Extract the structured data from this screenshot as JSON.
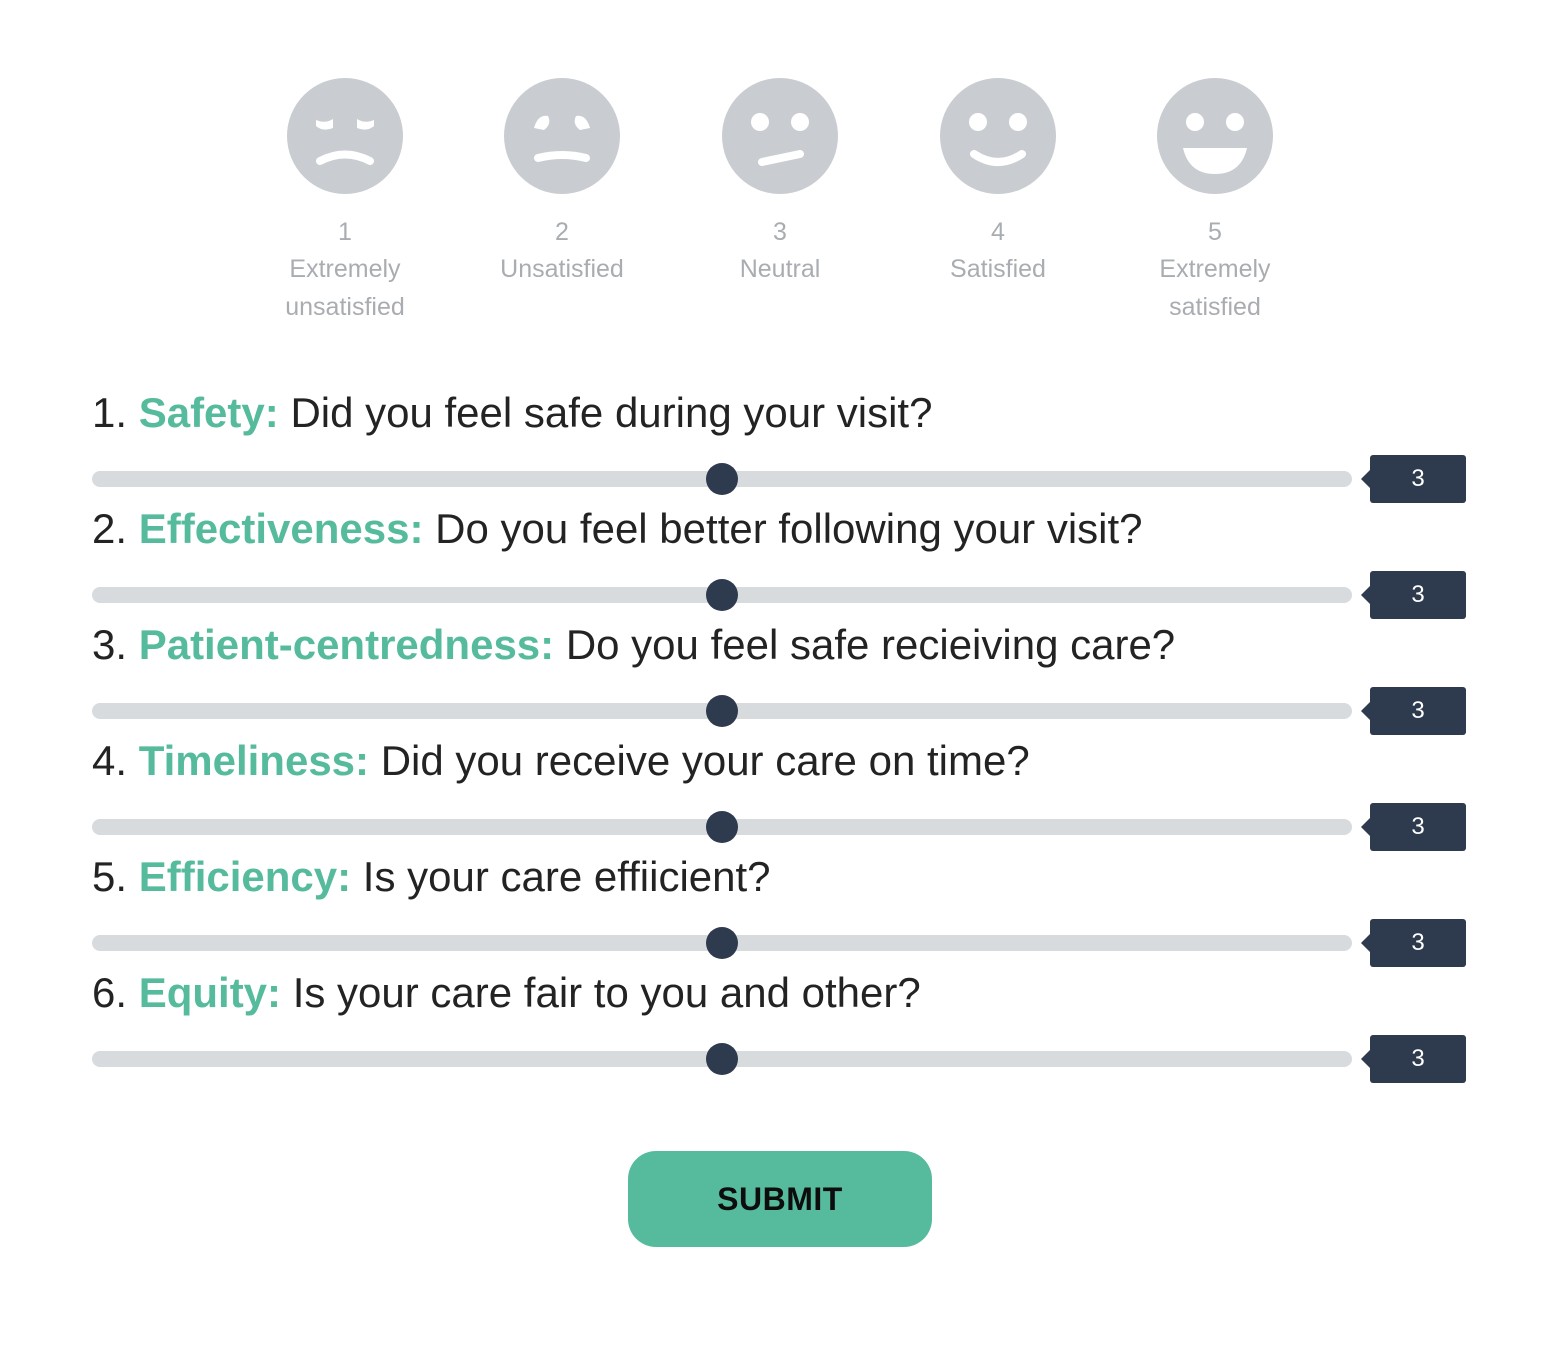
{
  "scale": [
    {
      "number": "1",
      "label_line1": "Extremely",
      "label_line2": "unsatisfied",
      "icon": "extremely-unsatisfied-face-icon"
    },
    {
      "number": "2",
      "label_line1": "Unsatisfied",
      "label_line2": "",
      "icon": "unsatisfied-face-icon"
    },
    {
      "number": "3",
      "label_line1": "Neutral",
      "label_line2": "",
      "icon": "neutral-face-icon"
    },
    {
      "number": "4",
      "label_line1": "Satisfied",
      "label_line2": "",
      "icon": "satisfied-face-icon"
    },
    {
      "number": "5",
      "label_line1": "Extremely",
      "label_line2": "satisfied",
      "icon": "extremely-satisfied-face-icon"
    }
  ],
  "slider_range": {
    "min": 1,
    "max": 5
  },
  "questions": [
    {
      "number": "1.",
      "category": "Safety:",
      "text": "Did you feel safe during your visit?",
      "value": 3,
      "value_label": "3"
    },
    {
      "number": "2.",
      "category": "Effectiveness:",
      "text": "Do you feel better following your visit?",
      "value": 3,
      "value_label": "3"
    },
    {
      "number": "3.",
      "category": "Patient-centredness:",
      "text": "Do you feel safe recieiving care?",
      "value": 3,
      "value_label": "3"
    },
    {
      "number": "4.",
      "category": "Timeliness:",
      "text": "Did you receive your care on time?",
      "value": 3,
      "value_label": "3"
    },
    {
      "number": "5.",
      "category": "Efficiency:",
      "text": "Is your care effiicient?",
      "value": 3,
      "value_label": "3"
    },
    {
      "number": "6.",
      "category": "Equity:",
      "text": "Is your care fair to you and other?",
      "value": 3,
      "value_label": "3"
    }
  ],
  "submit_label": "SUBMIT",
  "colors": {
    "accent": "#56bb9c",
    "face": "#c9cdd1",
    "track": "#d8dbde",
    "thumb": "#2e3a4d"
  }
}
